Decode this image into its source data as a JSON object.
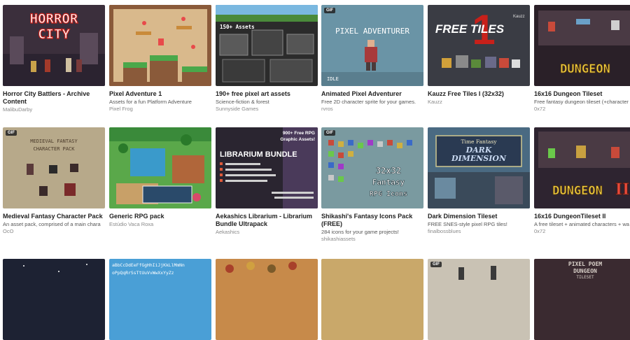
{
  "badge_label": "GIF",
  "cards": [
    {
      "title": "Horror City Battlers - Archive Content",
      "subtitle": "",
      "author": "MalibuDarby",
      "thumb_text": "HORROR CITY",
      "gif": false,
      "bg": "#3b2f3c"
    },
    {
      "title": "Pixel Adventure 1",
      "subtitle": "Assets for a fun Platform Adventure",
      "author": "Pixel Frog",
      "thumb_text": "",
      "gif": false,
      "bg": "#d9b98c"
    },
    {
      "title": "190+ free pixel art assets",
      "subtitle": "Science-fiction & forest",
      "author": "Sunnyside Games",
      "thumb_text": "150+ Assets",
      "gif": false,
      "bg": "#2b2b2b"
    },
    {
      "title": "Animated Pixel Adventurer",
      "subtitle": "Free 2D character sprite for your games.",
      "author": "rvros",
      "thumb_text": "PIXEL ADVENTURER",
      "thumb_text2": "IDLE",
      "gif": true,
      "bg": "#6a94a6"
    },
    {
      "title": "Kauzz Free Tiles I (32x32)",
      "subtitle": "",
      "author": "Kauzz",
      "thumb_text": "FREE TILES",
      "thumb_text2": "1",
      "gif": false,
      "bg": "#3a3c44"
    },
    {
      "title": "16x16 Dungeon Tileset",
      "subtitle": "Free fantasy dungeon tileset (+character",
      "author": "0x72",
      "thumb_text": "DUNGEON",
      "gif": false,
      "bg": "#2a2028"
    },
    {
      "title": "Medieval Fantasy Character Pack",
      "subtitle": "An asset pack, comprised of a main chara",
      "author": "OcO",
      "thumb_text": "MEDIEVAL FANTASY CHARACTER PACK",
      "gif": true,
      "bg": "#b7a98a"
    },
    {
      "title": "Generic RPG pack",
      "subtitle": "",
      "author": "Estúdio Vaca Roxa",
      "thumb_text": "",
      "gif": false,
      "bg": "#5aa84a"
    },
    {
      "title": "Aekashics Librarium - Librarium Bundle Ultrapack",
      "subtitle": "",
      "author": "Aekashics",
      "thumb_text": "LIBRARIUM BUNDLE",
      "thumb_text2": "900+ Free RPG Graphic Assets!",
      "gif": false,
      "bg": "#2a2530"
    },
    {
      "title": "Shikashi's Fantasy Icons Pack (FREE)",
      "subtitle": "284 icons for your game projects!",
      "author": "shikashiassets",
      "thumb_text": "32x32 Fantasy RPG Icons",
      "gif": true,
      "bg": "#7a9aa0"
    },
    {
      "title": "Dark Dimension Tileset",
      "subtitle": "FREE SNES-style pixel RPG tiles!",
      "author": "finalbossblues",
      "thumb_text": "DARK DIMENSION",
      "thumb_text2": "Time Fantasy",
      "gif": false,
      "bg": "#4a6a82"
    },
    {
      "title": "16x16 DungeonTileset II",
      "subtitle": "A free tileset + animated characters + wa",
      "author": "0x72",
      "thumb_text": "DUNGEON",
      "thumb_text2": "II",
      "gif": false,
      "bg": "#2e2430"
    },
    {
      "title": "",
      "subtitle": "",
      "author": "",
      "thumb_text": "",
      "gif": false,
      "bg": "#1d2233"
    },
    {
      "title": "",
      "subtitle": "",
      "author": "",
      "thumb_text": "aBbCcDdEeFfGgHhIiJjKkLlMmNn",
      "thumb_text2": "oPpQqRrSsTtUuVvWwXxYyZz",
      "gif": false,
      "bg": "#4a9fd6"
    },
    {
      "title": "",
      "subtitle": "",
      "author": "",
      "thumb_text": "",
      "gif": false,
      "bg": "#c78a4a"
    },
    {
      "title": "",
      "subtitle": "",
      "author": "",
      "thumb_text": "",
      "gif": false,
      "bg": "#c9a86a"
    },
    {
      "title": "",
      "subtitle": "",
      "author": "",
      "thumb_text": "",
      "gif": true,
      "bg": "#c9c2b4"
    },
    {
      "title": "",
      "subtitle": "",
      "author": "",
      "thumb_text": "PIXEL POEM DUNGEON TILESET",
      "gif": false,
      "bg": "#3a2a30"
    }
  ]
}
